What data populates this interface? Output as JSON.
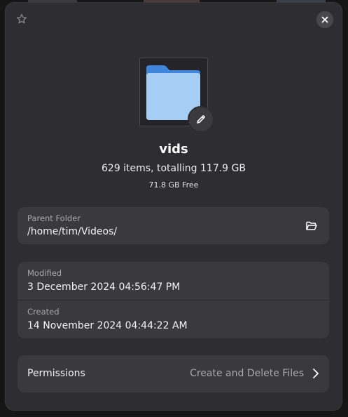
{
  "folder": {
    "name": "vids",
    "summary": "629 items, totalling 117.9 GB",
    "free_space": "71.8 GB Free",
    "icon": "folder-icon",
    "icon_color": "#5b9ae6"
  },
  "header": {
    "star_icon": "star-icon",
    "close_icon": "close-icon"
  },
  "location": {
    "label": "Parent Folder",
    "value": "/home/tim/Videos/",
    "open_icon": "folder-open-icon"
  },
  "dates": {
    "modified_label": "Modified",
    "modified_value": "3 December 2024 04:56:47 PM",
    "created_label": "Created",
    "created_value": "14 November 2024 04:44:22 AM"
  },
  "permissions": {
    "label": "Permissions",
    "value": "Create and Delete Files",
    "chevron_icon": "chevron-right-icon"
  }
}
